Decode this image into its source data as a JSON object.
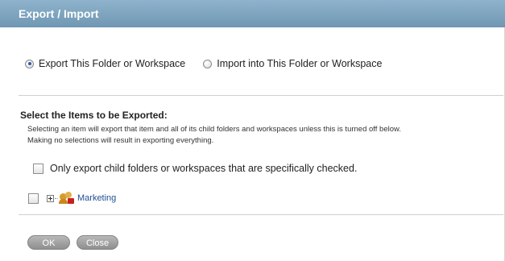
{
  "dialog": {
    "title": "Export / Import"
  },
  "mode": {
    "export_label": "Export This Folder or Workspace",
    "import_label": "Import into This Folder or Workspace",
    "selected": "export"
  },
  "selection": {
    "heading": "Select the Items to be Exported:",
    "hint_line1": "Selecting an item will export that item and all of its child folders and workspaces unless this is turned off below.",
    "hint_line2": "Making no selections will result in exporting everything.",
    "only_checked_label": "Only export child folders or workspaces that are specifically checked.",
    "only_checked_value": false
  },
  "tree": {
    "items": [
      {
        "label": "Marketing",
        "checked": false,
        "expanded": false,
        "icon": "team-workspace-locked-icon"
      }
    ]
  },
  "buttons": {
    "ok_label": "OK",
    "close_label": "Close"
  },
  "colors": {
    "titlebar": "#7aa0bd",
    "link": "#1f4f93",
    "button": "#a3a3a3"
  }
}
